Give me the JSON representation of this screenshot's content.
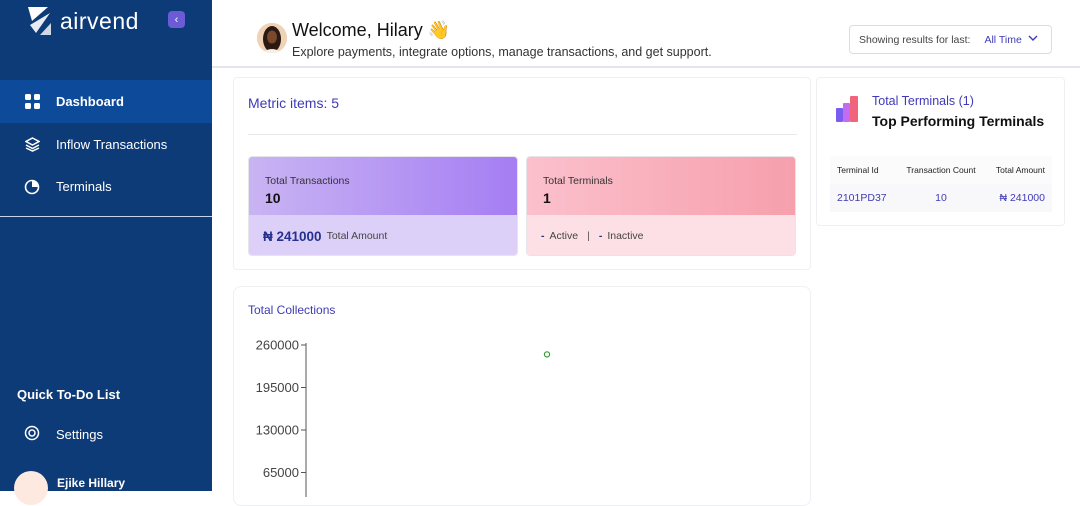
{
  "sidebar": {
    "brand": "airvend",
    "items": [
      {
        "label": "Dashboard",
        "icon": "grid-icon"
      },
      {
        "label": "Inflow Transactions",
        "icon": "layers-icon"
      },
      {
        "label": "Terminals",
        "icon": "pie-icon"
      }
    ],
    "todo_label": "Quick To-Do List",
    "settings_label": "Settings",
    "user_name": "Ejike Hillary"
  },
  "header": {
    "welcome": "Welcome, Hilary 👋",
    "subtitle": "Explore payments, integrate options, manage transactions, and get support.",
    "filter_label": "Showing results for last:",
    "filter_value": "All Time"
  },
  "metrics": {
    "title": "Metric items: 5",
    "cards": [
      {
        "label": "Total Transactions",
        "value": "10",
        "amount": "₦ 241000",
        "amount_label": "Total Amount"
      },
      {
        "label": "Total Terminals",
        "value": "1",
        "active_value": "-",
        "active_label": "Active",
        "inactive_value": "-",
        "inactive_label": "Inactive"
      }
    ]
  },
  "terminals": {
    "subtitle": "Total Terminals (1)",
    "title": "Top Performing Terminals",
    "columns": [
      "Terminal Id",
      "Transaction Count",
      "Total Amount"
    ],
    "rows": [
      [
        "2101PD37",
        "10",
        "₦ 241000"
      ]
    ]
  },
  "chart_data": {
    "type": "scatter",
    "title": "Total Collections",
    "y_ticks": [
      "260000",
      "195000",
      "130000",
      "65000"
    ],
    "ylim": [
      0,
      260000
    ],
    "points": [
      {
        "y": 241000
      }
    ],
    "accent_color": "#3a9a3a"
  }
}
